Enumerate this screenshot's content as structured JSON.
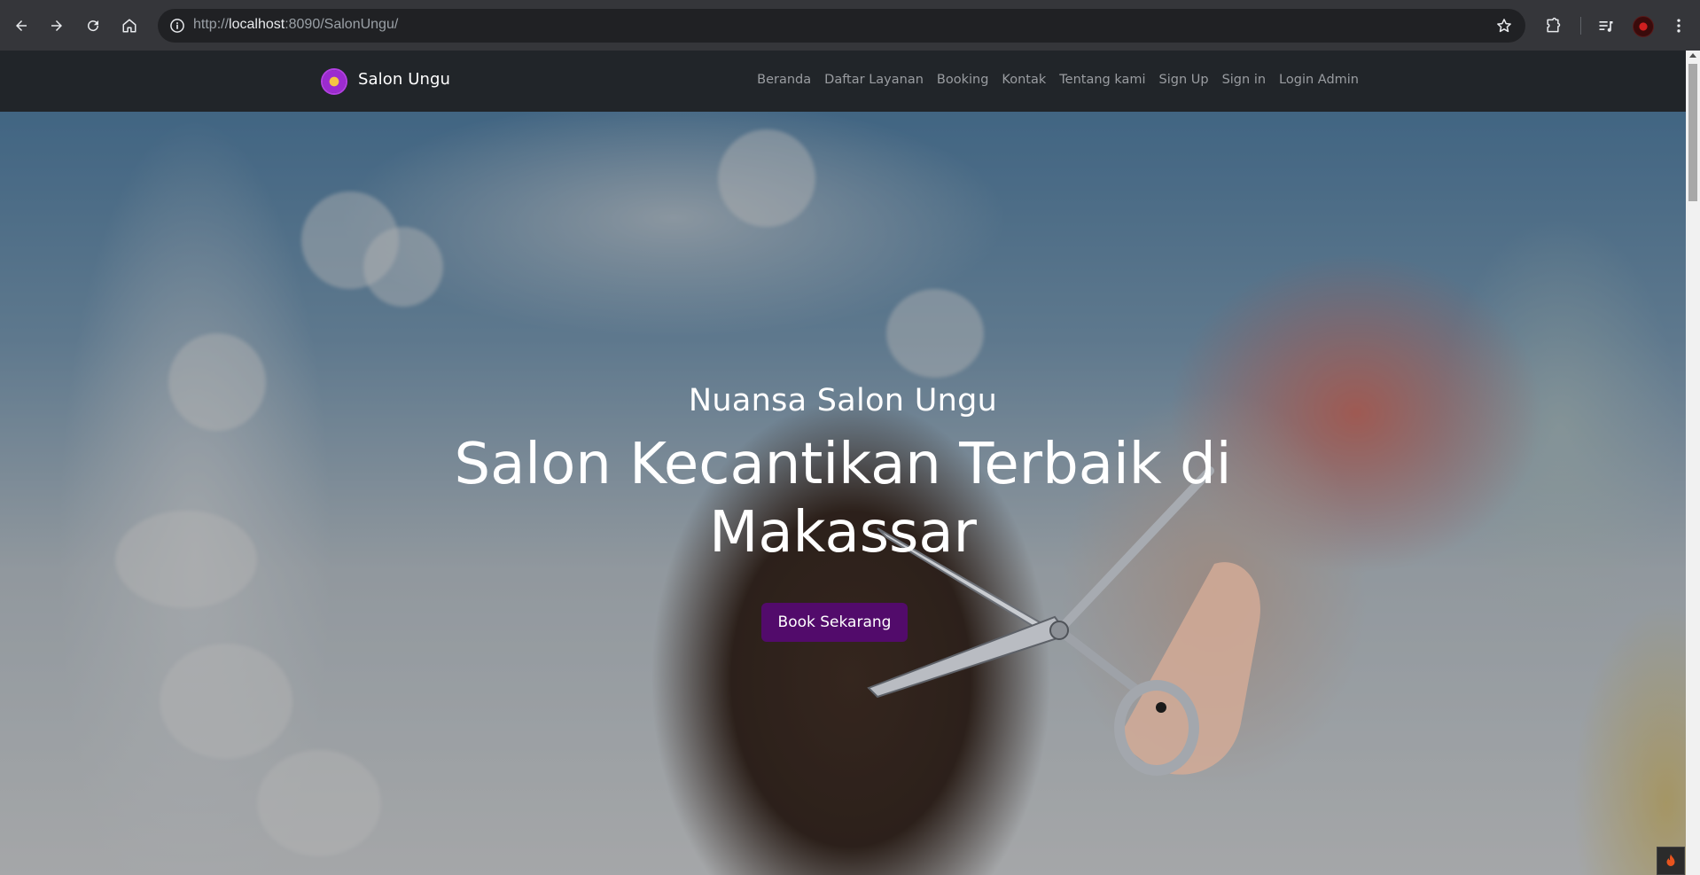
{
  "browser": {
    "url_scheme": "http://",
    "url_host": "localhost",
    "url_rest": ":8090/SalonUngu/",
    "icons": [
      "back-icon",
      "forward-icon",
      "reload-icon",
      "home-icon",
      "info-icon",
      "star-icon",
      "extensions-icon",
      "media-icon",
      "profile-avatar",
      "menu-icon"
    ]
  },
  "site": {
    "brand": "Salon Ungu",
    "nav": [
      "Beranda",
      "Daftar Layanan",
      "Booking",
      "Kontak",
      "Tentang kami",
      "Sign Up",
      "Sign in",
      "Login Admin"
    ]
  },
  "hero": {
    "subtitle": "Nuansa Salon Ungu",
    "title_line1": "Salon Kecantikan Terbaik di",
    "title_line2": "Makassar",
    "cta": "Book Sekarang"
  },
  "colors": {
    "navbar_bg": "#212529",
    "cta_bg": "#520b6b",
    "nav_link": "#9a9da1"
  }
}
